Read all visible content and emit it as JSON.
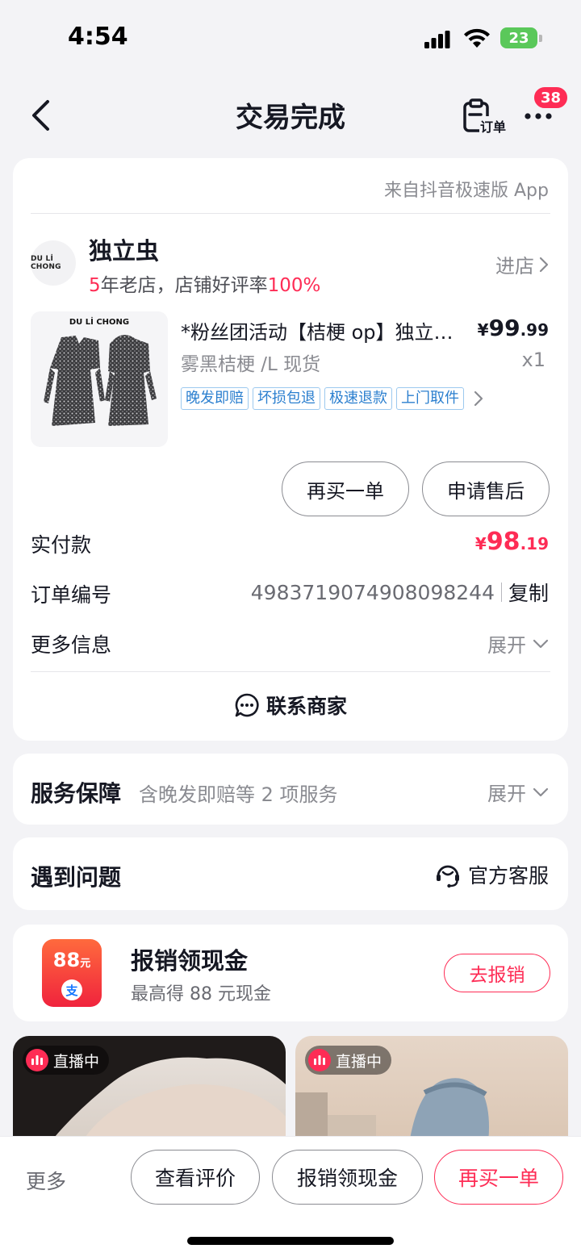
{
  "status_bar": {
    "time": "4:54",
    "battery": "23"
  },
  "nav": {
    "title": "交易完成",
    "order_label": "订单",
    "badge": "38"
  },
  "order_card": {
    "source": "来自抖音极速版 App",
    "shop": {
      "logo_text": "DU Lİ CHONG",
      "name": "独立虫",
      "years": "5",
      "tag_mid": "年老店，店铺好评率",
      "rate": "100%",
      "enter_label": "进店"
    },
    "product": {
      "image_brand": "DU Lİ CHONG",
      "title": "*粉丝团活动【桔梗 op】独立虫 春季新款",
      "price_symbol": "¥",
      "price_int": "99",
      "price_dec": ".99",
      "spec": "雾黑桔梗 /L 现货",
      "qty": "x1",
      "tags": [
        "晚发即赔",
        "坏损包退",
        "极速退款",
        "上门取件"
      ]
    },
    "buttons": {
      "rebuy": "再买一单",
      "after_sale": "申请售后"
    },
    "paid": {
      "label": "实付款",
      "symbol": "¥",
      "int": "98",
      "dec": ".19"
    },
    "order_no": {
      "label": "订单编号",
      "value": "4983719074908098244",
      "copy": "复制"
    },
    "more_info": {
      "label": "更多信息",
      "expand": "展开"
    },
    "contact": "联系商家"
  },
  "service": {
    "title": "服务保障",
    "desc": "含晚发即赔等 2 项服务",
    "expand": "展开"
  },
  "problem": {
    "title": "遇到问题",
    "support": "官方客服"
  },
  "cash": {
    "icon_amount": "88",
    "icon_unit": "元",
    "icon_pay": "支",
    "title": "报销领现金",
    "sub": "最高得 88 元现金",
    "button": "去报销"
  },
  "live": [
    {
      "badge": "直播中"
    },
    {
      "badge": "直播中"
    }
  ],
  "bottom": {
    "more": "更多",
    "review": "查看评价",
    "cash": "报销领现金",
    "rebuy": "再买一单"
  },
  "colors": {
    "accent": "#fe2c55",
    "tag_blue": "#2b7fcf",
    "background": "#f3f3f6"
  }
}
